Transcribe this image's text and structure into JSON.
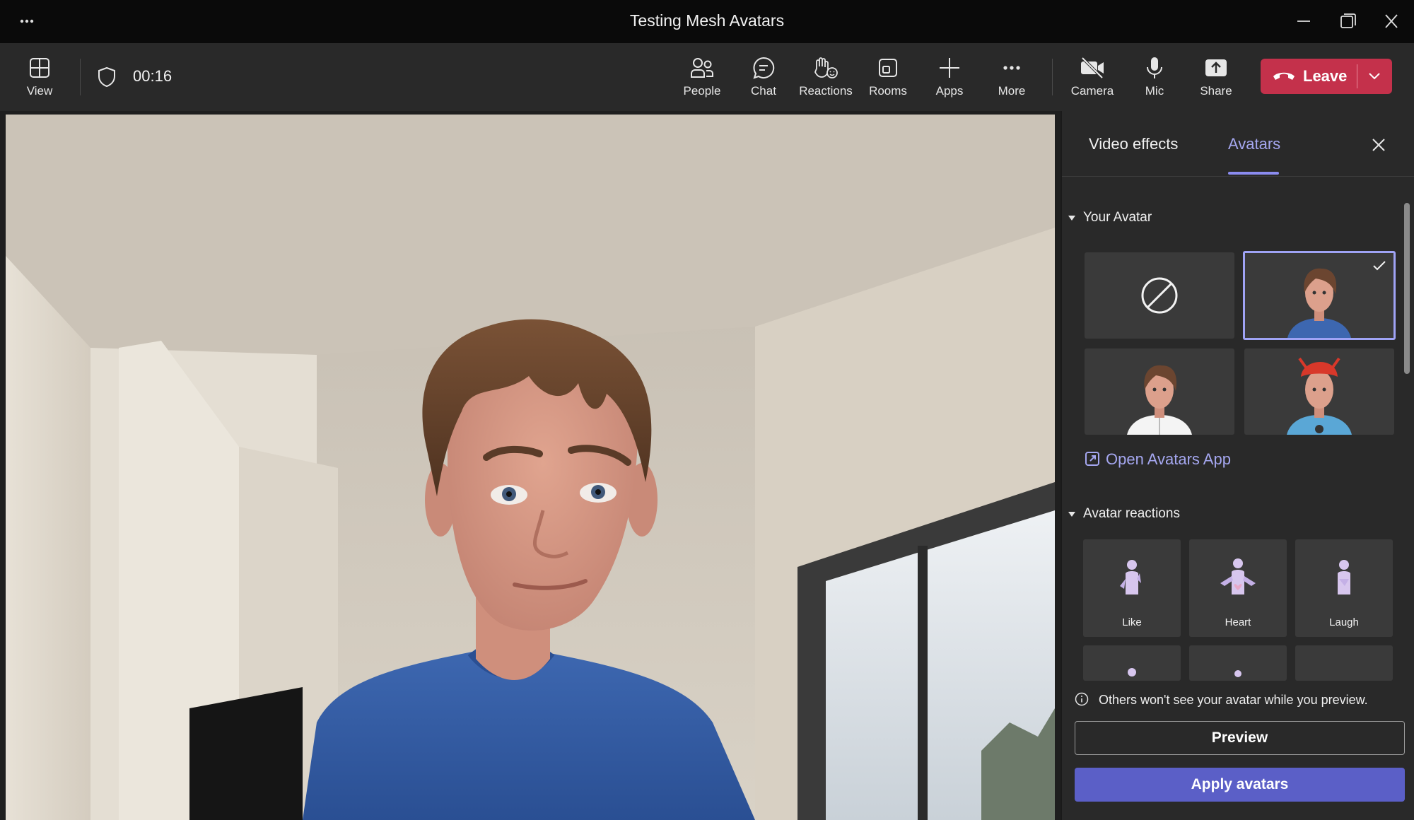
{
  "window": {
    "title": "Testing Mesh Avatars",
    "menu_icon": "more-horizontal-icon",
    "controls": [
      "minimize-icon",
      "restore-icon",
      "close-icon"
    ]
  },
  "toolbar": {
    "view_label": "View",
    "timer": "00:16",
    "people_label": "People",
    "chat_label": "Chat",
    "reactions_label": "Reactions",
    "rooms_label": "Rooms",
    "apps_label": "Apps",
    "more_label": "More",
    "camera_label": "Camera",
    "mic_label": "Mic",
    "share_label": "Share",
    "leave_label": "Leave",
    "leave_color": "#c4314b"
  },
  "panel": {
    "tabs": [
      {
        "label": "Video effects",
        "active": false
      },
      {
        "label": "Avatars",
        "active": true
      }
    ],
    "accent": "#8b8cf0",
    "your_avatar": {
      "heading": "Your Avatar",
      "tiles": [
        {
          "kind": "none",
          "icon": "prohibited-icon",
          "selected": false
        },
        {
          "kind": "avatar-blue-shirt",
          "selected": true
        },
        {
          "kind": "avatar-white-shirt",
          "selected": false
        },
        {
          "kind": "avatar-red-hat",
          "selected": false
        }
      ]
    },
    "open_app_label": "Open Avatars App",
    "avatar_reactions": {
      "heading": "Avatar reactions",
      "items": [
        {
          "label": "Like"
        },
        {
          "label": "Heart"
        },
        {
          "label": "Laugh"
        }
      ]
    },
    "info_text": "Others won't see your avatar while you preview.",
    "preview_label": "Preview",
    "apply_label": "Apply avatars",
    "apply_color": "#5b5fc7"
  }
}
